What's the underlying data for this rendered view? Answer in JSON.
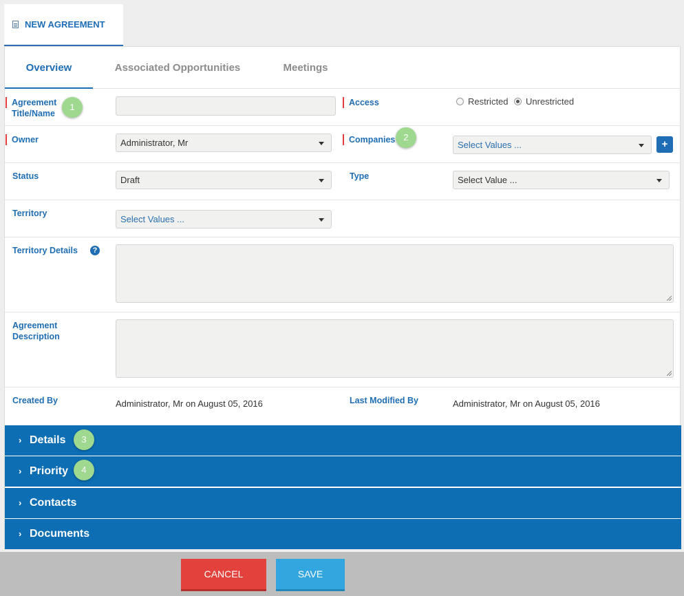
{
  "page_tab": {
    "label": "NEW AGREEMENT",
    "icon": "document-icon"
  },
  "tabs": [
    "Overview",
    "Associated Opportunities",
    "Meetings"
  ],
  "active_tab": "Overview",
  "fields": {
    "title": {
      "label_line1": "Agreement",
      "label_line2": "Title/Name",
      "value": ""
    },
    "access": {
      "label": "Access",
      "options": [
        "Restricted",
        "Unrestricted"
      ],
      "selected": "Unrestricted"
    },
    "owner": {
      "label": "Owner",
      "value": "Administrator, Mr"
    },
    "companies": {
      "label": "Companies",
      "placeholder": "Select Values ...",
      "add_label": "+"
    },
    "status": {
      "label": "Status",
      "value": "Draft"
    },
    "type": {
      "label": "Type",
      "placeholder": "Select Value ..."
    },
    "territory": {
      "label": "Territory",
      "placeholder": "Select Values ..."
    },
    "territory_details": {
      "label": "Territory Details",
      "help": "?",
      "value": ""
    },
    "description": {
      "label_line1": "Agreement",
      "label_line2": "Description",
      "value": ""
    },
    "created_by": {
      "label": "Created By",
      "value": "Administrator, Mr on August 05, 2016"
    },
    "modified_by": {
      "label": "Last Modified By",
      "value": "Administrator, Mr on August 05, 2016"
    }
  },
  "sections": [
    {
      "chevron": "›",
      "label": "Details"
    },
    {
      "chevron": "›",
      "label": "Priority"
    },
    {
      "chevron": "›",
      "label": "Contacts"
    },
    {
      "chevron": "›",
      "label": "Documents"
    }
  ],
  "callouts": [
    "1",
    "2",
    "3",
    "4"
  ],
  "buttons": {
    "cancel": "CANCEL",
    "save": "SAVE"
  },
  "colors": {
    "primary": "#1e6db5",
    "section_bar": "#0d6eb4",
    "cancel": "#e3413c",
    "save": "#33a6e0",
    "required_marker": "#e33b3b",
    "callout": "#9fd88f"
  }
}
